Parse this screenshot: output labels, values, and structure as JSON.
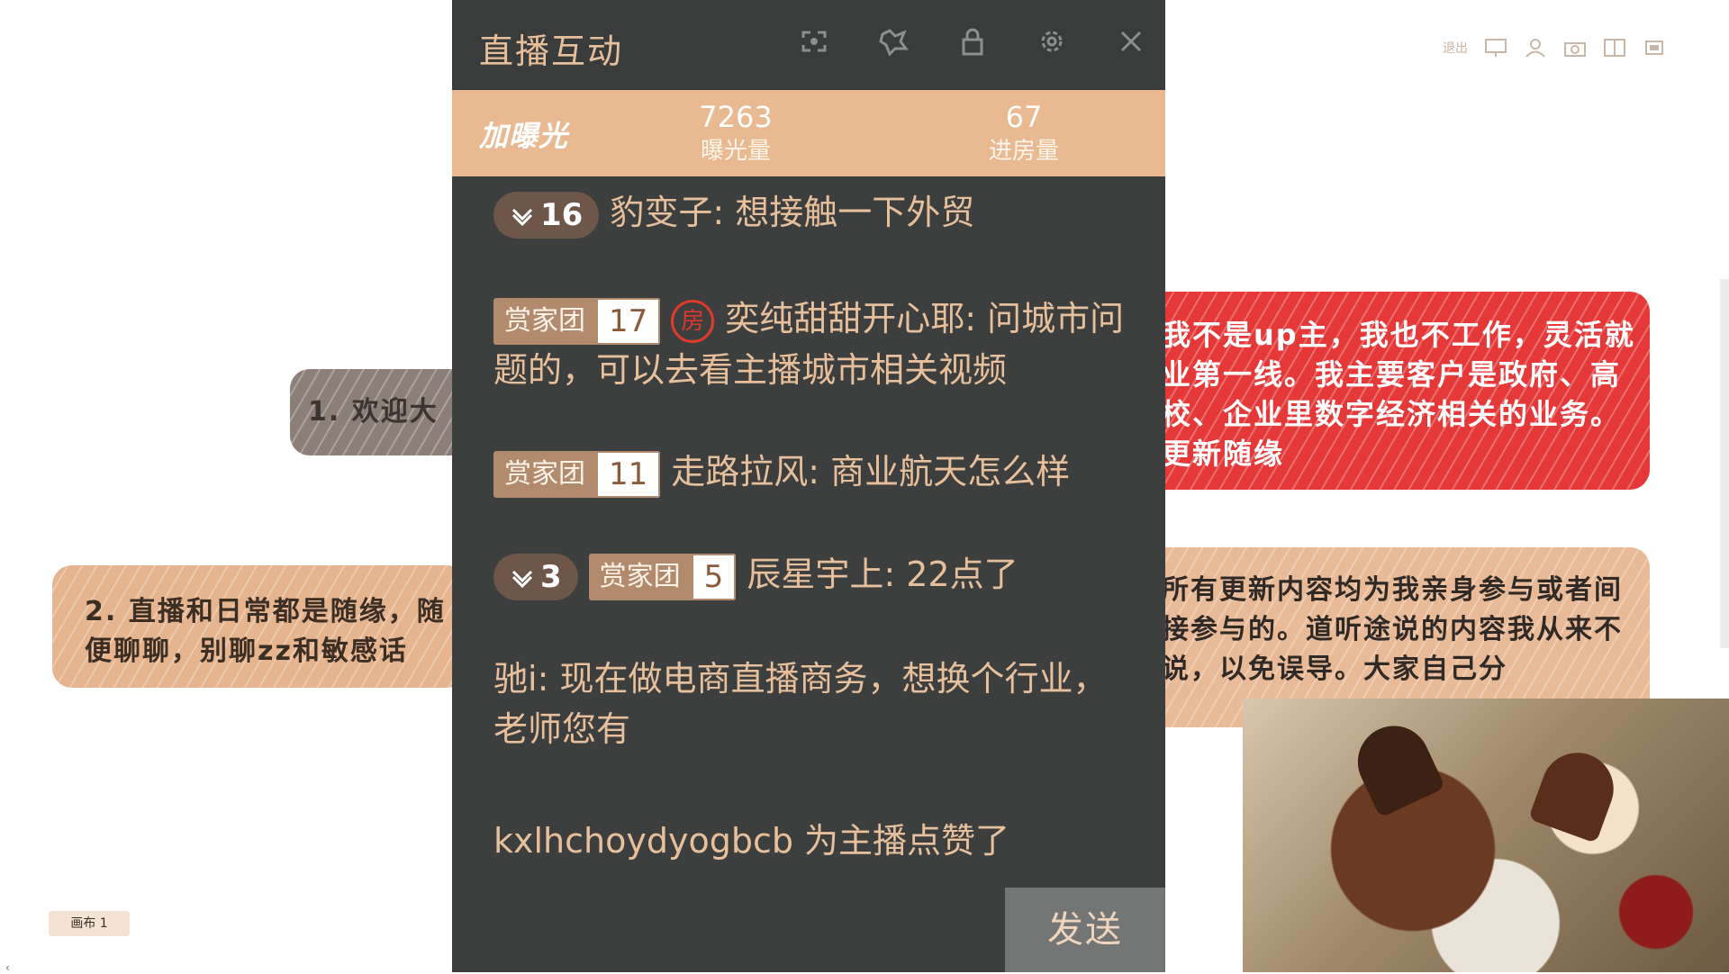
{
  "panel": {
    "title": "直播互动",
    "header_icons": [
      "screen-share-icon",
      "effects-icon",
      "lock-icon",
      "settings-icon",
      "close-icon"
    ],
    "boost_label": "加曝光",
    "exposure": {
      "value": "7263",
      "label": "曝光量"
    },
    "entries": {
      "value": "67",
      "label": "进房量"
    },
    "send_label": "发送"
  },
  "messages": [
    {
      "level": "16",
      "user": "豹变子",
      "text": "想接触一下外贸"
    },
    {
      "fan_name": "赏家团",
      "fan_level": "17",
      "room_badge": "房",
      "user": "奕纯甜甜开心耶",
      "text": "问城市问题的，可以去看主播城市相关视频"
    },
    {
      "fan_name": "赏家团",
      "fan_level": "11",
      "user": "走路拉风",
      "text": "商业航天怎么样"
    },
    {
      "level": "3",
      "fan_name": "赏家团",
      "fan_level": "5",
      "user": "辰星宇上",
      "text": "22点了"
    },
    {
      "user": "驰i",
      "text": "现在做电商直播商务，想换个行业，老师您有"
    },
    {
      "system": "kxlhchoydyogbcb 为主播点赞了"
    }
  ],
  "canvas": {
    "notes": {
      "gray": "1. 欢迎大",
      "tan": "2. 直播和日常都是随缘，随便聊聊，别聊zz和敏感话",
      "red": "我不是up主，我也不工作，灵活就业第一线。我主要客户是政府、高校、企业里数字经济相关的业务。更新随缘",
      "peach": "所有更新内容均为我亲身参与或者间接参与的。道听途说的内容我从来不说，以免误导。大家自己分"
    },
    "tab_label": "画布 1",
    "top_tool_text": "退出",
    "colors": {
      "panel_bg": "#3d3e3e",
      "accent": "#e9b992",
      "red_note": "#e53839",
      "text_peach": "#e7bf9a"
    }
  }
}
